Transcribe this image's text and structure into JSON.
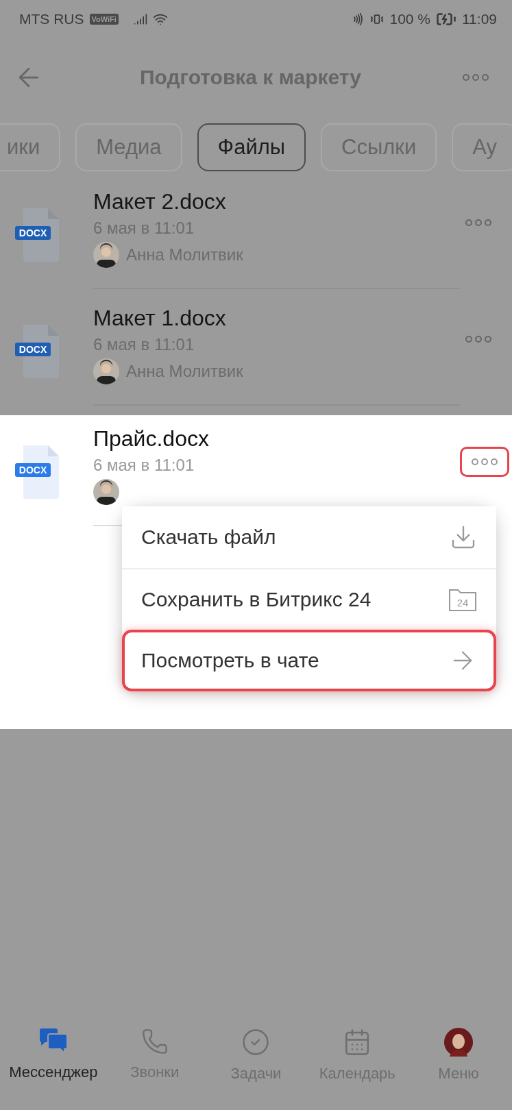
{
  "status_bar": {
    "carrier": "MTS RUS",
    "wifi_calling": "VoWiFi",
    "battery": "100 %",
    "time": "11:09"
  },
  "header": {
    "title": "Подготовка к маркету"
  },
  "tabs": [
    {
      "label": "ики",
      "selected": false
    },
    {
      "label": "Медиа",
      "selected": false
    },
    {
      "label": "Файлы",
      "selected": true
    },
    {
      "label": "Ссылки",
      "selected": false
    },
    {
      "label": "Ау",
      "selected": false
    }
  ],
  "files": [
    {
      "name": "Макет 2.docx",
      "badge": "DOCX",
      "date": "6 мая в 11:01",
      "author": "Анна Молитвик",
      "focused": false
    },
    {
      "name": "Макет 1.docx",
      "badge": "DOCX",
      "date": "6 мая в 11:01",
      "author": "Анна Молитвик",
      "focused": false
    },
    {
      "name": "Прайс.docx",
      "badge": "DOCX",
      "date": "6 мая в 11:01",
      "focused": true
    }
  ],
  "context_menu": {
    "items": [
      {
        "label": "Скачать файл",
        "kind": "download",
        "highlighted": false
      },
      {
        "label": "Сохранить в Битрикс 24",
        "kind": "save",
        "icon_label": "24",
        "highlighted": false
      },
      {
        "label": "Посмотреть в чате",
        "kind": "open",
        "highlighted": true
      }
    ]
  },
  "bottom_nav": [
    {
      "label": "Мессенджер",
      "kind": "chat",
      "selected": true
    },
    {
      "label": "Звонки",
      "kind": "phone",
      "selected": false
    },
    {
      "label": "Задачи",
      "kind": "tasks",
      "selected": false
    },
    {
      "label": "Календарь",
      "kind": "calendar",
      "selected": false
    },
    {
      "label": "Меню",
      "kind": "avatar",
      "selected": false
    }
  ]
}
